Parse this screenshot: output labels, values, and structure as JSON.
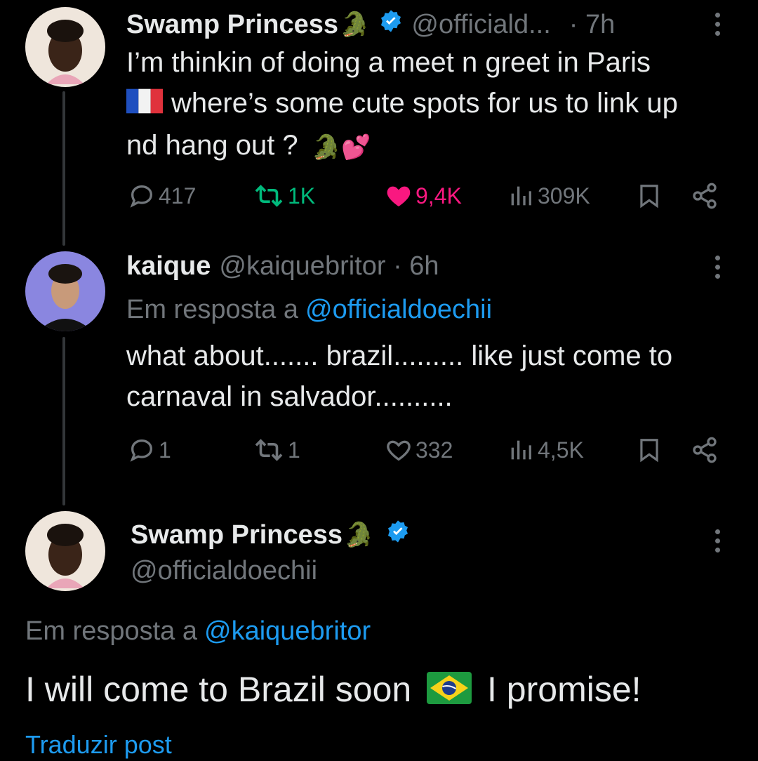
{
  "tweet1": {
    "author_name": "Swamp Princess",
    "author_emoji": "🐊",
    "author_handle": "@officiald...",
    "time": "· 7h",
    "text_line1": "I’m thinkin of doing a meet n greet in Paris",
    "text_line2": "where’s some cute spots for us to link up",
    "text_line3": "nd hang out ?",
    "emoji_end": "🐊💕",
    "stats": {
      "replies": "417",
      "reposts": "1K",
      "likes": "9,4K",
      "views": "309K"
    }
  },
  "tweet2": {
    "author_name": "kaique",
    "author_handle": "@kaiquebritor · 6h",
    "reply_prefix": "Em resposta a",
    "reply_to": "@officialdoechii",
    "text_line1": "what about....... brazil......... like just come to",
    "text_line2": "carnaval in salvador..........",
    "stats": {
      "replies": "1",
      "reposts": "1",
      "likes": "332",
      "views": "4,5K"
    }
  },
  "tweet3": {
    "author_name": "Swamp Princess",
    "author_emoji": "🐊",
    "author_handle": "@officialdoechii",
    "reply_prefix": "Em resposta a",
    "reply_to": "@kaiquebritor",
    "text_before": "I will come to Brazil soon",
    "text_after": "I promise!",
    "translate": "Traduzir post"
  },
  "colors": {
    "background": "#000000",
    "text": "#e7e9ea",
    "muted": "#71767b",
    "link": "#1d9bf0",
    "like": "#f91880",
    "repost": "#00ba7c"
  }
}
